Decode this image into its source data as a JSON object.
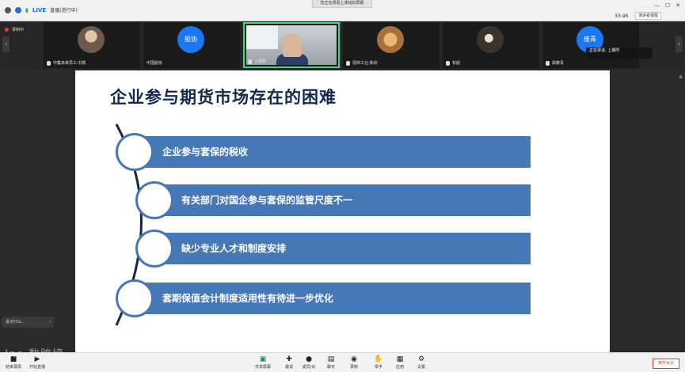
{
  "topbar": {
    "live_label": "LIVE",
    "live_status": "直播(进行中)",
    "share_banner": "您正在观看上课班的屏幕",
    "clock": "33:46",
    "view_button": "演讲者视图"
  },
  "strip": {
    "recording_label": "录制中",
    "participants": [
      {
        "name": "中集未来员工-刘凯",
        "avatar": "photo-face"
      },
      {
        "name": "中国船协",
        "avatar": "blue",
        "avatar_text": "船协"
      },
      {
        "name": "上期所",
        "avatar": "video"
      },
      {
        "name": "招商工业-陈欣",
        "avatar": "photo-cat"
      },
      {
        "name": "有船",
        "avatar": "photo-dark"
      },
      {
        "name": "鼎泰青",
        "avatar": "blue",
        "avatar_text": "维青"
      }
    ],
    "speaking_label": "正在讲话: 上期所"
  },
  "slide": {
    "title": "企业参与期货市场存在的困难",
    "items": [
      "企业参与套保的税收",
      "有关部门对国企参与套保的监管尺度不一",
      "缺少专业人才和制度安排",
      "套期保值会计制度适用性有待进一步优化"
    ]
  },
  "chat_pill": "说点什么...",
  "watermark": "Ino 数跨境",
  "toolbar": {
    "left": [
      {
        "label": "结束录屏",
        "icon": "record-stop-icon"
      },
      {
        "label": "开始直播",
        "icon": "live-icon"
      }
    ],
    "center": [
      {
        "label": "共享屏幕",
        "icon": "screen-share-icon",
        "glyph": "▣"
      },
      {
        "label": "邀请",
        "icon": "invite-icon",
        "glyph": "✚"
      },
      {
        "label": "成员(9)",
        "icon": "members-icon",
        "glyph": "●"
      },
      {
        "label": "聊天",
        "icon": "chat-icon",
        "glyph": "▤"
      },
      {
        "label": "录制",
        "icon": "record-icon",
        "glyph": "◉"
      },
      {
        "label": "举手",
        "icon": "hand-icon",
        "glyph": "✋"
      },
      {
        "label": "应用",
        "icon": "apps-icon",
        "glyph": "▦"
      },
      {
        "label": "设置",
        "icon": "settings-icon",
        "glyph": "⚙"
      }
    ],
    "leave_label": "离开会议"
  }
}
